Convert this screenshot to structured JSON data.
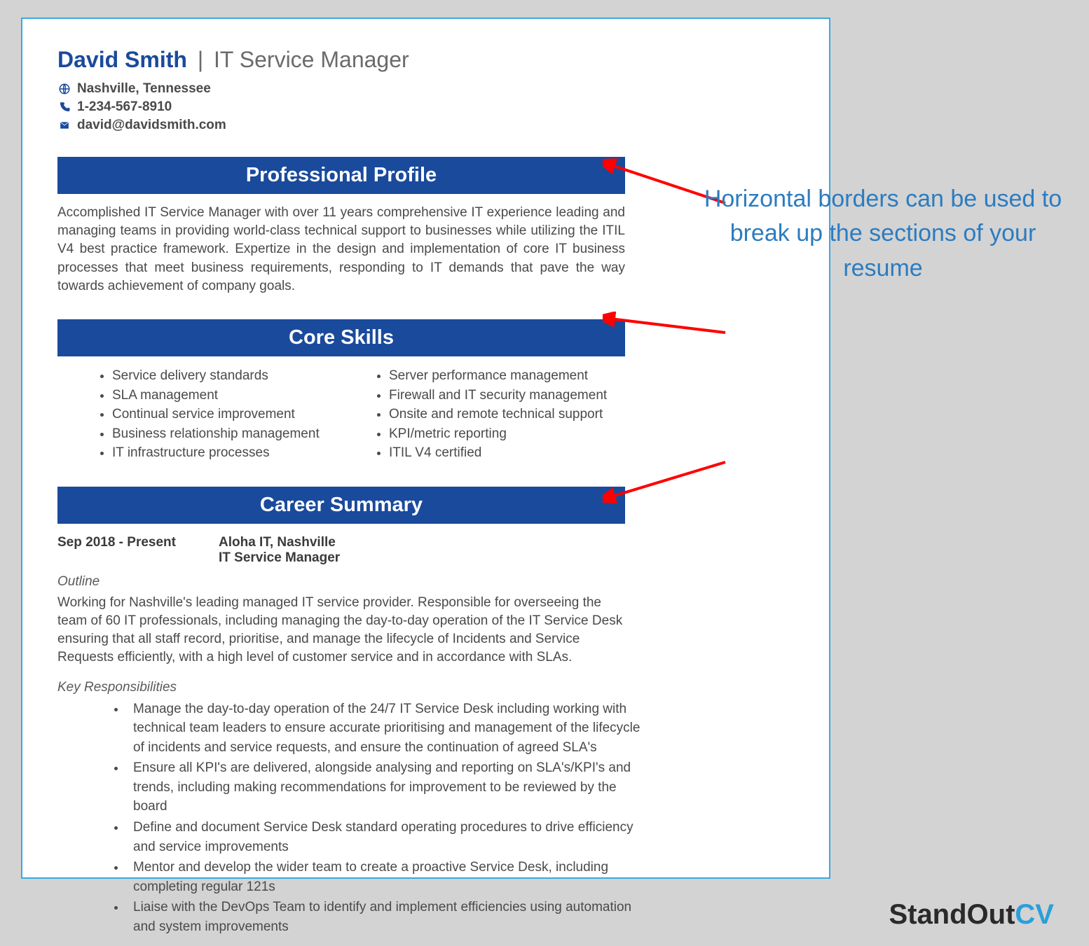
{
  "header": {
    "name": "David Smith",
    "title": "IT Service Manager"
  },
  "contact": {
    "location": "Nashville, Tennessee",
    "phone": "1-234-567-8910",
    "email": "david@davidsmith.com"
  },
  "sections": {
    "profile_title": "Professional Profile",
    "profile_body": "Accomplished IT Service Manager with over 11 years comprehensive IT experience leading and managing teams in providing world-class technical support to businesses while utilizing the ITIL V4 best practice framework. Expertize in the design and implementation of core IT business processes that meet business requirements, responding to IT demands that pave the way towards achievement of company goals.",
    "skills_title": "Core Skills",
    "skills_left": [
      "Service delivery standards",
      "SLA management",
      "Continual service improvement",
      "Business relationship management",
      "IT infrastructure processes"
    ],
    "skills_right": [
      "Server performance management",
      "Firewall and IT security management",
      "Onsite and remote technical support",
      "KPI/metric reporting",
      "ITIL V4 certified"
    ],
    "career_title": "Career Summary"
  },
  "job": {
    "dates": "Sep 2018 - Present",
    "company": "Aloha IT, Nashville",
    "role": "IT Service Manager",
    "outline_label": "Outline",
    "outline_body": "Working for Nashville's leading managed IT service provider. Responsible for overseeing the team of 60 IT professionals, including managing the day-to-day operation of the IT Service Desk ensuring that all staff record, prioritise, and manage the lifecycle of Incidents and Service Requests efficiently, with a high level of customer service and in accordance with SLAs.",
    "resp_label": "Key Responsibilities",
    "resp": [
      "Manage the day-to-day operation of the 24/7 IT Service Desk including working with technical team leaders to ensure accurate prioritising and management of the lifecycle of incidents and service requests, and ensure the continuation of agreed SLA's",
      "Ensure all KPI's are delivered, alongside analysing and reporting on SLA's/KPI's and trends, including making recommendations for improvement to be reviewed by the board",
      "Define and document Service Desk standard operating procedures to drive efficiency and service improvements",
      "Mentor and develop the wider team to create a proactive Service Desk, including completing regular 121s",
      "Liaise with the DevOps Team to identify and implement efficiencies using automation and system improvements"
    ]
  },
  "annotation": {
    "text": "Horizontal borders can be used to break up the sections of your resume"
  },
  "brand": {
    "part1": "StandOut",
    "part2": "CV"
  }
}
